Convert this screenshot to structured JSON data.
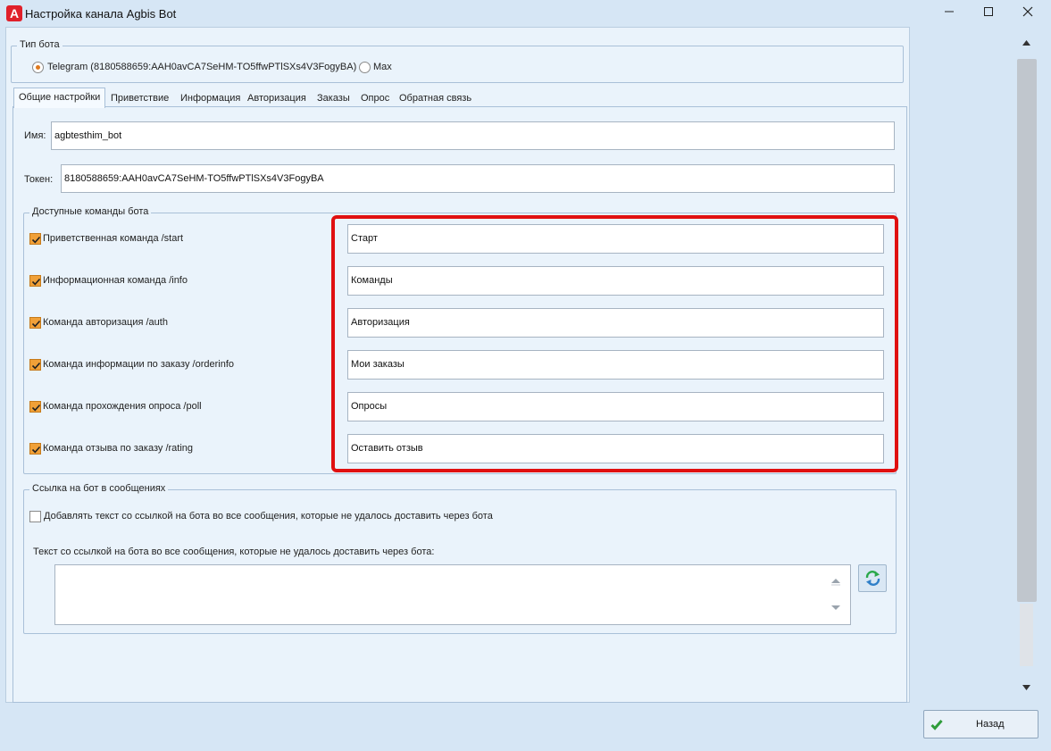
{
  "window": {
    "title": "Настройка канала  Agbis Bot",
    "app_icon_letter": "A"
  },
  "bot_type": {
    "legend": "Тип бота",
    "options": [
      {
        "label": "Telegram (8180588659:AAH0avCA7SeHM-TO5ffwPTlSXs4V3FogyBA)",
        "selected": true
      },
      {
        "label": "Max",
        "selected": false
      }
    ]
  },
  "tabs": [
    {
      "label": "Общие настройки",
      "active": true
    },
    {
      "label": "Приветствие",
      "active": false
    },
    {
      "label": "Информация",
      "active": false
    },
    {
      "label": "Авторизация",
      "active": false
    },
    {
      "label": "Заказы",
      "active": false
    },
    {
      "label": "Опрос",
      "active": false
    },
    {
      "label": "Обратная связь",
      "active": false
    }
  ],
  "general": {
    "name_label": "Имя:",
    "name_value": "agbtesthim_bot",
    "token_label": "Токен:",
    "token_value": "8180588659:AAH0avCA7SeHM-TO5ffwPTlSXs4V3FogyBA"
  },
  "commands": {
    "legend": "Доступные команды бота",
    "items": [
      {
        "label": "Приветственная команда /start",
        "checked": true,
        "value": "Старт"
      },
      {
        "label": "Информационная команда /info",
        "checked": true,
        "value": "Команды"
      },
      {
        "label": "Команда авторизация /auth",
        "checked": true,
        "value": "Авторизация"
      },
      {
        "label": "Команда информации по заказу /orderinfo",
        "checked": true,
        "value": "Мои заказы"
      },
      {
        "label": "Команда прохождения опроса /poll",
        "checked": true,
        "value": "Опросы"
      },
      {
        "label": "Команда отзыва по заказу /rating",
        "checked": true,
        "value": "Оставить отзыв"
      }
    ],
    "highlight_color": "#e01010"
  },
  "bot_link": {
    "legend": "Ссылка на бот в сообщениях",
    "add_link_label": "Добавлять текст со ссылкой на бота во все сообщения, которые не удалось доставить через бота",
    "add_link_checked": false,
    "text_label": "Текст со ссылкой на бота во все сообщения, которые не удалось доставить через бота:",
    "text_value": ""
  },
  "footer": {
    "back_label": "Назад"
  },
  "colors": {
    "accent_orange": "#f0a038",
    "back_check_green": "#2e9c3a",
    "refresh_green": "#2aa84a",
    "refresh_blue": "#2f7fc8"
  },
  "icons": {
    "app": "agbis-logo-icon",
    "minimize": "minimize-icon",
    "maximize": "maximize-icon",
    "close": "close-icon",
    "refresh": "refresh-icon",
    "back": "checkmark-icon"
  }
}
